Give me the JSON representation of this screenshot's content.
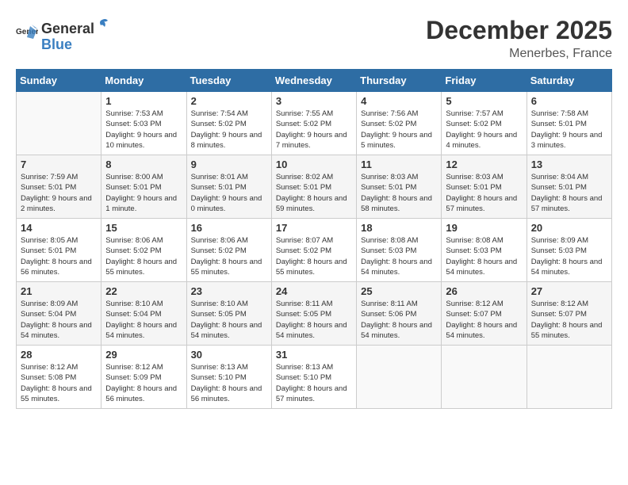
{
  "header": {
    "logo_general": "General",
    "logo_blue": "Blue",
    "title": "December 2025",
    "subtitle": "Menerbes, France"
  },
  "calendar": {
    "headers": [
      "Sunday",
      "Monday",
      "Tuesday",
      "Wednesday",
      "Thursday",
      "Friday",
      "Saturday"
    ],
    "weeks": [
      [
        {
          "day": "",
          "sunrise": "",
          "sunset": "",
          "daylight": ""
        },
        {
          "day": "1",
          "sunrise": "Sunrise: 7:53 AM",
          "sunset": "Sunset: 5:03 PM",
          "daylight": "Daylight: 9 hours and 10 minutes."
        },
        {
          "day": "2",
          "sunrise": "Sunrise: 7:54 AM",
          "sunset": "Sunset: 5:02 PM",
          "daylight": "Daylight: 9 hours and 8 minutes."
        },
        {
          "day": "3",
          "sunrise": "Sunrise: 7:55 AM",
          "sunset": "Sunset: 5:02 PM",
          "daylight": "Daylight: 9 hours and 7 minutes."
        },
        {
          "day": "4",
          "sunrise": "Sunrise: 7:56 AM",
          "sunset": "Sunset: 5:02 PM",
          "daylight": "Daylight: 9 hours and 5 minutes."
        },
        {
          "day": "5",
          "sunrise": "Sunrise: 7:57 AM",
          "sunset": "Sunset: 5:02 PM",
          "daylight": "Daylight: 9 hours and 4 minutes."
        },
        {
          "day": "6",
          "sunrise": "Sunrise: 7:58 AM",
          "sunset": "Sunset: 5:01 PM",
          "daylight": "Daylight: 9 hours and 3 minutes."
        }
      ],
      [
        {
          "day": "7",
          "sunrise": "Sunrise: 7:59 AM",
          "sunset": "Sunset: 5:01 PM",
          "daylight": "Daylight: 9 hours and 2 minutes."
        },
        {
          "day": "8",
          "sunrise": "Sunrise: 8:00 AM",
          "sunset": "Sunset: 5:01 PM",
          "daylight": "Daylight: 9 hours and 1 minute."
        },
        {
          "day": "9",
          "sunrise": "Sunrise: 8:01 AM",
          "sunset": "Sunset: 5:01 PM",
          "daylight": "Daylight: 9 hours and 0 minutes."
        },
        {
          "day": "10",
          "sunrise": "Sunrise: 8:02 AM",
          "sunset": "Sunset: 5:01 PM",
          "daylight": "Daylight: 8 hours and 59 minutes."
        },
        {
          "day": "11",
          "sunrise": "Sunrise: 8:03 AM",
          "sunset": "Sunset: 5:01 PM",
          "daylight": "Daylight: 8 hours and 58 minutes."
        },
        {
          "day": "12",
          "sunrise": "Sunrise: 8:03 AM",
          "sunset": "Sunset: 5:01 PM",
          "daylight": "Daylight: 8 hours and 57 minutes."
        },
        {
          "day": "13",
          "sunrise": "Sunrise: 8:04 AM",
          "sunset": "Sunset: 5:01 PM",
          "daylight": "Daylight: 8 hours and 57 minutes."
        }
      ],
      [
        {
          "day": "14",
          "sunrise": "Sunrise: 8:05 AM",
          "sunset": "Sunset: 5:01 PM",
          "daylight": "Daylight: 8 hours and 56 minutes."
        },
        {
          "day": "15",
          "sunrise": "Sunrise: 8:06 AM",
          "sunset": "Sunset: 5:02 PM",
          "daylight": "Daylight: 8 hours and 55 minutes."
        },
        {
          "day": "16",
          "sunrise": "Sunrise: 8:06 AM",
          "sunset": "Sunset: 5:02 PM",
          "daylight": "Daylight: 8 hours and 55 minutes."
        },
        {
          "day": "17",
          "sunrise": "Sunrise: 8:07 AM",
          "sunset": "Sunset: 5:02 PM",
          "daylight": "Daylight: 8 hours and 55 minutes."
        },
        {
          "day": "18",
          "sunrise": "Sunrise: 8:08 AM",
          "sunset": "Sunset: 5:03 PM",
          "daylight": "Daylight: 8 hours and 54 minutes."
        },
        {
          "day": "19",
          "sunrise": "Sunrise: 8:08 AM",
          "sunset": "Sunset: 5:03 PM",
          "daylight": "Daylight: 8 hours and 54 minutes."
        },
        {
          "day": "20",
          "sunrise": "Sunrise: 8:09 AM",
          "sunset": "Sunset: 5:03 PM",
          "daylight": "Daylight: 8 hours and 54 minutes."
        }
      ],
      [
        {
          "day": "21",
          "sunrise": "Sunrise: 8:09 AM",
          "sunset": "Sunset: 5:04 PM",
          "daylight": "Daylight: 8 hours and 54 minutes."
        },
        {
          "day": "22",
          "sunrise": "Sunrise: 8:10 AM",
          "sunset": "Sunset: 5:04 PM",
          "daylight": "Daylight: 8 hours and 54 minutes."
        },
        {
          "day": "23",
          "sunrise": "Sunrise: 8:10 AM",
          "sunset": "Sunset: 5:05 PM",
          "daylight": "Daylight: 8 hours and 54 minutes."
        },
        {
          "day": "24",
          "sunrise": "Sunrise: 8:11 AM",
          "sunset": "Sunset: 5:05 PM",
          "daylight": "Daylight: 8 hours and 54 minutes."
        },
        {
          "day": "25",
          "sunrise": "Sunrise: 8:11 AM",
          "sunset": "Sunset: 5:06 PM",
          "daylight": "Daylight: 8 hours and 54 minutes."
        },
        {
          "day": "26",
          "sunrise": "Sunrise: 8:12 AM",
          "sunset": "Sunset: 5:07 PM",
          "daylight": "Daylight: 8 hours and 54 minutes."
        },
        {
          "day": "27",
          "sunrise": "Sunrise: 8:12 AM",
          "sunset": "Sunset: 5:07 PM",
          "daylight": "Daylight: 8 hours and 55 minutes."
        }
      ],
      [
        {
          "day": "28",
          "sunrise": "Sunrise: 8:12 AM",
          "sunset": "Sunset: 5:08 PM",
          "daylight": "Daylight: 8 hours and 55 minutes."
        },
        {
          "day": "29",
          "sunrise": "Sunrise: 8:12 AM",
          "sunset": "Sunset: 5:09 PM",
          "daylight": "Daylight: 8 hours and 56 minutes."
        },
        {
          "day": "30",
          "sunrise": "Sunrise: 8:13 AM",
          "sunset": "Sunset: 5:10 PM",
          "daylight": "Daylight: 8 hours and 56 minutes."
        },
        {
          "day": "31",
          "sunrise": "Sunrise: 8:13 AM",
          "sunset": "Sunset: 5:10 PM",
          "daylight": "Daylight: 8 hours and 57 minutes."
        },
        {
          "day": "",
          "sunrise": "",
          "sunset": "",
          "daylight": ""
        },
        {
          "day": "",
          "sunrise": "",
          "sunset": "",
          "daylight": ""
        },
        {
          "day": "",
          "sunrise": "",
          "sunset": "",
          "daylight": ""
        }
      ]
    ]
  }
}
